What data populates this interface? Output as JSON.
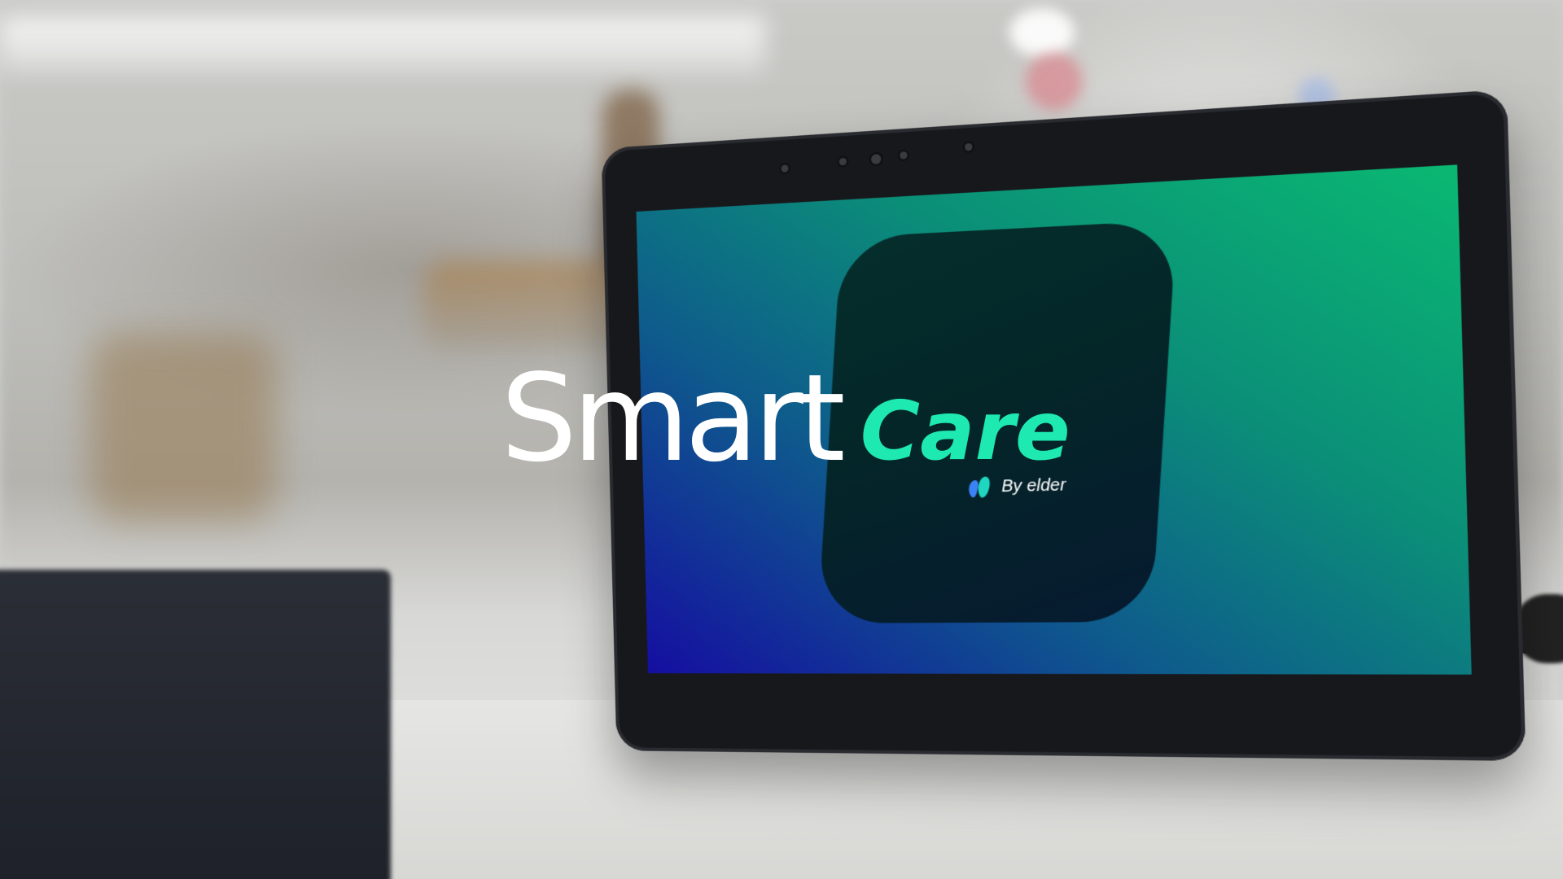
{
  "title": {
    "word1": "Smart",
    "word2": "Care",
    "word2_color": "#1EE9B0"
  },
  "device_screen": {
    "brand_text": "By elder",
    "brand_icon": "elder-logo-icon",
    "gradient_colors": [
      "#0AB872",
      "#0E5B8C",
      "#150EA1"
    ]
  }
}
